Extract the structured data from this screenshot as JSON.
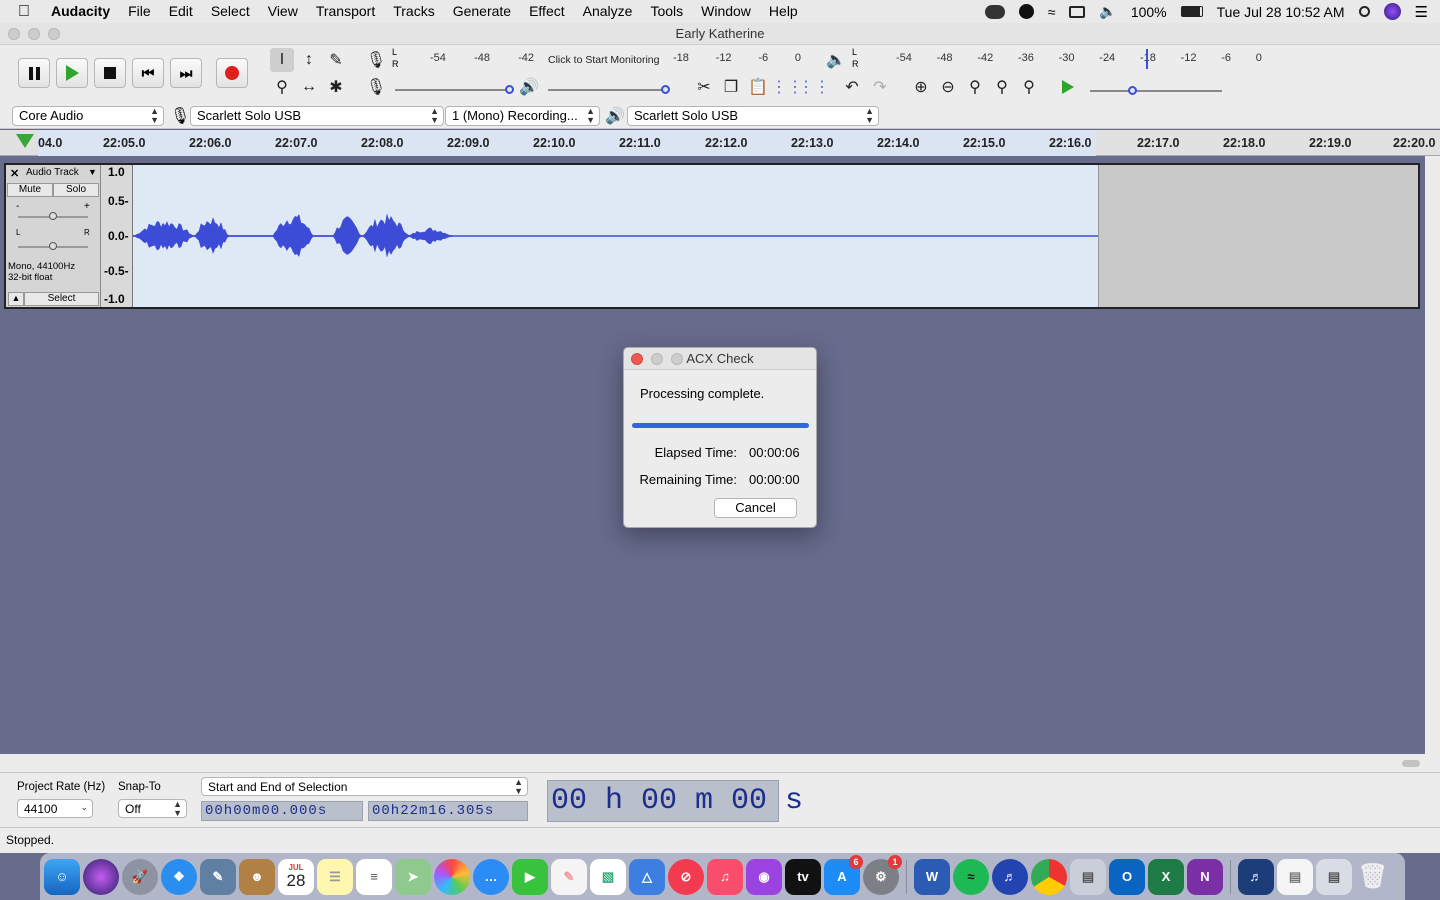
{
  "menubar": {
    "app_name": "Audacity",
    "items": [
      "File",
      "Edit",
      "Select",
      "View",
      "Transport",
      "Tracks",
      "Generate",
      "Effect",
      "Analyze",
      "Tools",
      "Window",
      "Help"
    ],
    "battery": "100%",
    "datetime": "Tue Jul 28  10:52 AM"
  },
  "window": {
    "title": "Early Katherine"
  },
  "toolbar": {
    "meter_click_label": "Click to Start Monitoring",
    "rec_meter_ticks": [
      "-54",
      "-48",
      "-42",
      "-18",
      "-12",
      "-6",
      "0"
    ],
    "play_meter_ticks": [
      "-54",
      "-48",
      "-42",
      "-36",
      "-30",
      "-24",
      "-18",
      "-12",
      "-6",
      "0"
    ],
    "lr": [
      "L",
      "R"
    ]
  },
  "devices": {
    "host": "Core Audio",
    "recording_device": "Scarlett Solo USB",
    "channels": "1 (Mono) Recording...",
    "playback_device": "Scarlett Solo USB"
  },
  "ruler": {
    "ticks": [
      "04.0",
      "22:05.0",
      "22:06.0",
      "22:07.0",
      "22:08.0",
      "22:09.0",
      "22:10.0",
      "22:11.0",
      "22:12.0",
      "22:13.0",
      "22:14.0",
      "22:15.0",
      "22:16.0",
      "22:17.0",
      "22:18.0",
      "22:19.0",
      "22:20.0"
    ]
  },
  "track": {
    "name": "Audio Track",
    "mute": "Mute",
    "solo": "Solo",
    "gain_minus": "-",
    "gain_plus": "+",
    "pan_l": "L",
    "pan_r": "R",
    "info_line1": "Mono, 44100Hz",
    "info_line2": "32-bit float",
    "select": "Select",
    "scale": [
      "1.0",
      "0.5-",
      "0.0-",
      "-0.5-",
      "-1.0"
    ]
  },
  "dialog": {
    "title": "ACX Check",
    "message": "Processing complete.",
    "progress": 1.0,
    "elapsed_label": "Elapsed Time:",
    "elapsed_value": "00:00:06",
    "remaining_label": "Remaining Time:",
    "remaining_value": "00:00:00",
    "cancel": "Cancel"
  },
  "selection_bar": {
    "project_rate_label": "Project Rate (Hz)",
    "project_rate_value": "44100",
    "snap_label": "Snap-To",
    "snap_value": "Off",
    "selection_mode": "Start and End of Selection",
    "start_time": "00h00m00.000s",
    "end_time": "00h22m16.305s",
    "audio_position": "00 h 00 m 00 s"
  },
  "status": {
    "text": "Stopped."
  },
  "dock": {
    "badges": {
      "app_store": "6",
      "system_prefs": "1"
    },
    "calendar_day": "28",
    "calendar_month": "JUL"
  },
  "colors": {
    "waveform": "#3d4cd6",
    "background": "#676b8c",
    "close_red": "#ee5a52",
    "progress": "#3366dd",
    "timecode": "#1c2e8a"
  }
}
